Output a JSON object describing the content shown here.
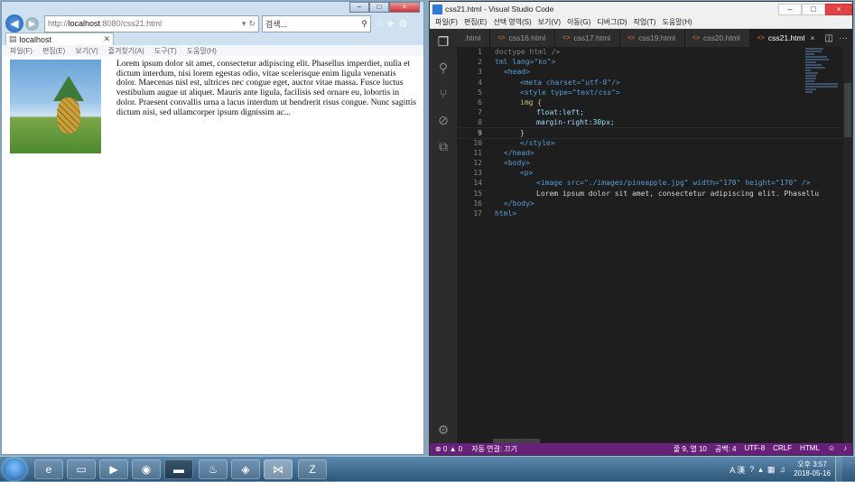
{
  "ie": {
    "caption_buttons": [
      "–",
      "□",
      "×"
    ],
    "address": {
      "prefix": "http://",
      "host": "localhost",
      "path": ":8080/css21.html"
    },
    "search_placeholder": "검색...",
    "tab_title": "localhost",
    "menu": [
      "파일(F)",
      "편집(E)",
      "보기(V)",
      "즐겨찾기(A)",
      "도구(T)",
      "도움말(H)"
    ],
    "paragraph": "Lorem ipsum dolor sit amet, consectetur adipiscing elit. Phasellus imperdiet, nulla et dictum interdum, nisi lorem egestas odio, vitae scelerisque enim ligula venenatis dolor. Maecenas nisl est, ultrices nec congue eget, auctor vitae massa. Fusce luctus vestibulum augue ut aliquet. Mauris ante ligula, facilisis sed ornare eu, lobortis in dolor. Praesent convallis urna a lacus interdum ut hendrerit risus congue. Nunc sagittis dictum nisi, sed ullamcorper ipsum dignissim ac..."
  },
  "vscode": {
    "title": "css21.html - Visual Studio Code",
    "menu": [
      "파일(F)",
      "편집(E)",
      "선택 영역(S)",
      "보기(V)",
      "이동(G)",
      "디버그(D)",
      "작업(T)",
      "도움말(H)"
    ],
    "tabs": [
      ".html",
      "css16.html",
      "css17.html",
      "css19.html",
      "css20.html",
      "css21.html"
    ],
    "active_tab": "css21.html",
    "lines": [
      {
        "n": "1",
        "text": "doctype html />"
      },
      {
        "n": "2",
        "text": "tml lang=\"ko\">"
      },
      {
        "n": "3",
        "text": "<head>"
      },
      {
        "n": "4",
        "text": "<meta charset=\"utf-8\"/>"
      },
      {
        "n": "5",
        "text": "<style type=\"text/css\">"
      },
      {
        "n": "6",
        "text": "img {"
      },
      {
        "n": "7",
        "text": "float:left;"
      },
      {
        "n": "8",
        "text": "margin-right:30px;"
      },
      {
        "n": "9",
        "text": "}"
      },
      {
        "n": "10",
        "text": "</style>"
      },
      {
        "n": "11",
        "text": "</head>"
      },
      {
        "n": "12",
        "text": "<body>"
      },
      {
        "n": "13",
        "text": "<p>"
      },
      {
        "n": "14",
        "text": "<image src=\"./images/pineapple.jpg\" width=\"170\" height=\"170\" />"
      },
      {
        "n": "15",
        "text": "Lorem ipsum dolor sit amet, consectetur adipiscing elit. Phasellu"
      },
      {
        "n": "16",
        "text": "</body>"
      },
      {
        "n": "17",
        "text": "html>"
      }
    ],
    "status": {
      "problems": "⊗ 0 ▲ 0",
      "autosave": "자동 연결: 끄기",
      "position": "줄 9, 열 10",
      "spaces": "공백: 4",
      "encoding": "UTF-8",
      "eol": "CRLF",
      "language": "HTML"
    }
  },
  "taskbar": {
    "apps": [
      "ie-icon",
      "explorer-icon",
      "media-player-icon",
      "chrome-icon",
      "cmd-icon",
      "java-icon",
      "eclipse-icon",
      "vscode-icon",
      "filezilla-icon"
    ],
    "tray": {
      "ime": "A 漢",
      "time": "오후 3:57",
      "date": "2018-05-16"
    }
  }
}
